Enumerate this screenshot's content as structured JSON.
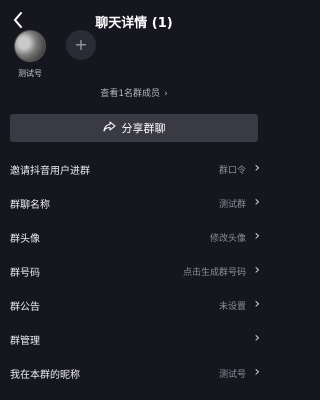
{
  "header": {
    "title": "聊天详情 (1)"
  },
  "members": {
    "items": [
      {
        "name": "测试号"
      }
    ],
    "add_symbol": "+"
  },
  "view_all": {
    "label": "查看1名群成员",
    "chevron": "›"
  },
  "share": {
    "label": "分享群聊"
  },
  "settings": {
    "rows": [
      {
        "label": "邀请抖音用户进群",
        "value": "群口令"
      },
      {
        "label": "群聊名称",
        "value": "测试群"
      },
      {
        "label": "群头像",
        "value": "修改头像"
      },
      {
        "label": "群号码",
        "value": "点击生成群号码"
      },
      {
        "label": "群公告",
        "value": "未设置"
      },
      {
        "label": "群管理",
        "value": ""
      },
      {
        "label": "我在本群的昵称",
        "value": "测试号"
      }
    ]
  }
}
